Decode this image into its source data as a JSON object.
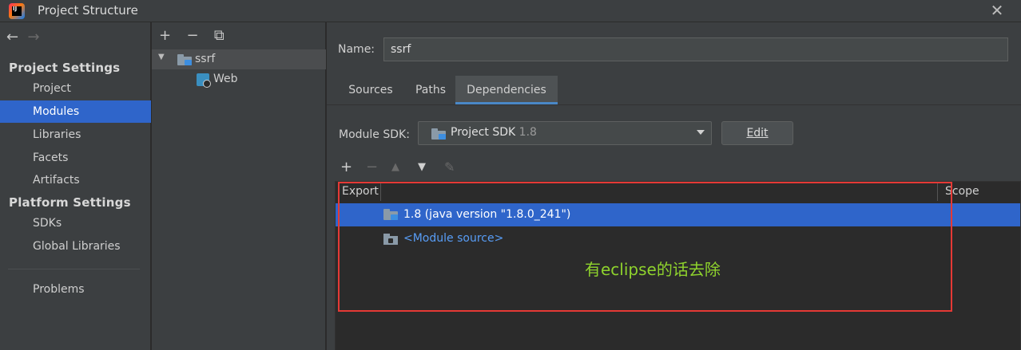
{
  "window": {
    "title": "Project Structure",
    "close_glyph": "✕",
    "app_icon_text": "IJ"
  },
  "nav": {
    "back_glyph": "←",
    "forward_glyph": "→"
  },
  "sidebar": {
    "project_settings_heading": "Project Settings",
    "platform_settings_heading": "Platform Settings",
    "items": [
      {
        "label": "Project"
      },
      {
        "label": "Modules"
      },
      {
        "label": "Libraries"
      },
      {
        "label": "Facets"
      },
      {
        "label": "Artifacts"
      },
      {
        "label": "SDKs"
      },
      {
        "label": "Global Libraries"
      },
      {
        "label": "Problems"
      }
    ],
    "selected": "Modules"
  },
  "modules_tree": {
    "toolbar": {
      "add": "+",
      "remove": "−",
      "copy": "⧉"
    },
    "items": [
      {
        "label": "ssrf",
        "icon": "module-folder-icon",
        "expanded": true
      },
      {
        "label": "Web",
        "icon": "web-facet-icon"
      }
    ]
  },
  "module": {
    "name_label": "Name:",
    "name_value": "ssrf",
    "tabs": [
      {
        "label": "Sources"
      },
      {
        "label": "Paths"
      },
      {
        "label": "Dependencies"
      }
    ],
    "active_tab": "Dependencies"
  },
  "dependencies": {
    "sdk_label": "Module SDK:",
    "sdk_value": "Project SDK",
    "sdk_version": "1.8",
    "edit_label": "Edit",
    "toolbar": {
      "add": "+",
      "remove": "−",
      "up": "▲",
      "down": "▼",
      "edit": "✎"
    },
    "columns": [
      "Export",
      "Scope"
    ],
    "rows": [
      {
        "label": "1.8 (java version \"1.8.0_241\")",
        "selected": true
      },
      {
        "label": "<Module source>",
        "selected": false
      }
    ]
  },
  "annotation": {
    "text": "有eclipse的话去除",
    "box_color": "#e53935",
    "text_color": "#8fd32d"
  },
  "colors": {
    "selection": "#2f65ca",
    "panel": "#3c3f41",
    "background": "#2b2b2b",
    "link": "#589df6"
  }
}
